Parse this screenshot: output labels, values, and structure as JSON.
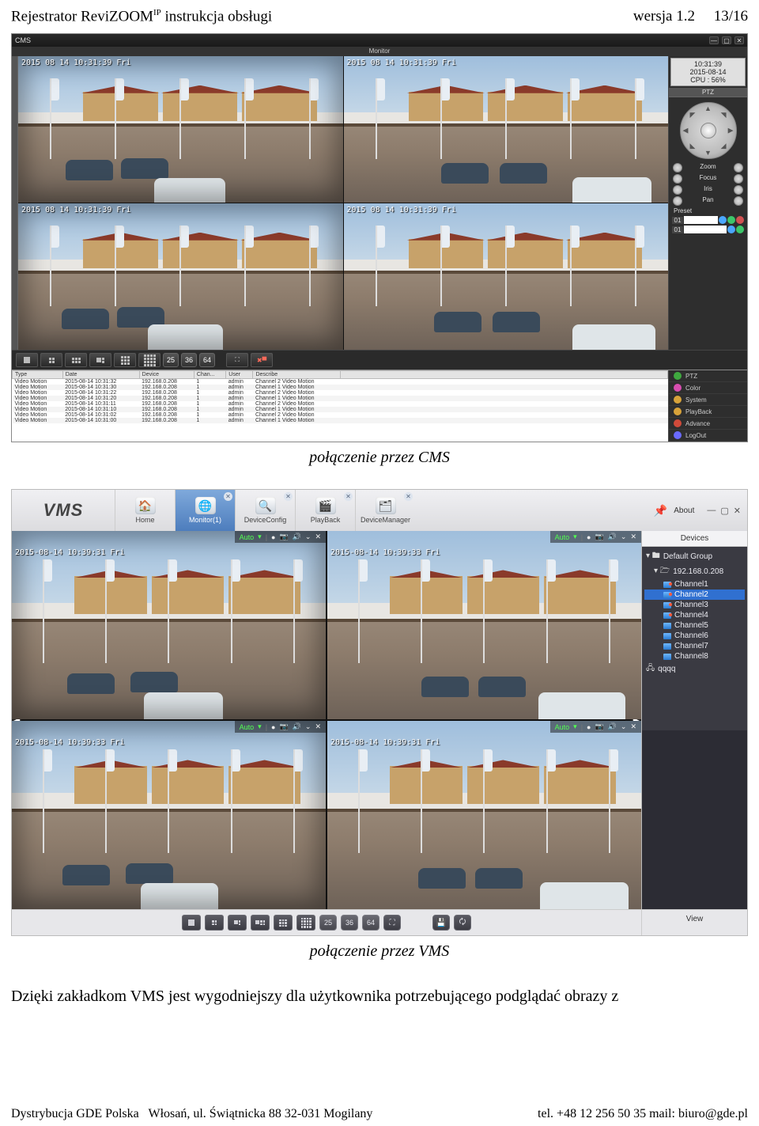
{
  "header": {
    "left_pre": "Rejestrator ReviZOOM",
    "left_sup": "IP",
    "left_post": " instrukcja obsługi",
    "right": "wersja 1.2     13/16"
  },
  "captions": {
    "cms": "połączenie przez CMS",
    "vms": "połączenie przez VMS"
  },
  "body_text": "Dzięki zakładkom VMS jest wygodniejszy dla użytkownika potrzebującego podglądać obrazy z",
  "footer": {
    "left": "Dystrybucja GDE Polska   Włosań, ul. Świątnicka 88 32-031 Mogilany",
    "right": "tel. +48 12 256 50 35 mail: biuro@gde.pl"
  },
  "cms": {
    "title": "CMS",
    "monitor_label": "Monitor",
    "time": {
      "clock": "10:31:39",
      "date": "2015-08-14",
      "cpu": "CPU : 56%"
    },
    "rail": {
      "ptz_label": "PTZ",
      "sliders": [
        "Zoom",
        "Focus",
        "Iris",
        "Pan"
      ],
      "preset_label": "Preset",
      "preset1": "01",
      "preset2": "01"
    },
    "grid_numbers": [
      "25",
      "36",
      "64"
    ],
    "feeds": {
      "ts1": "2015 08 14 10:31:39 Fri",
      "ts2": "2015 08 14 10:31:39 Fri",
      "ts3": "2015 08 14 10:31:39 Fri",
      "ts4": "2015 08 14 10:31:39 Fri"
    },
    "log_headers": [
      "Type",
      "Date",
      "Device",
      "Chan...",
      "User",
      "Describe"
    ],
    "log_rows": [
      [
        "Video Motion",
        "2015-08-14 10:31:32",
        "192.168.0.208",
        "1",
        "admin",
        "Channel 2 Video Motion"
      ],
      [
        "Video Motion",
        "2015-08-14 10:31:30",
        "192.168.0.208",
        "1",
        "admin",
        "Channel 1 Video Motion"
      ],
      [
        "Video Motion",
        "2015-08-14 10:31:22",
        "192.168.0.208",
        "1",
        "admin",
        "Channel 2 Video Motion"
      ],
      [
        "Video Motion",
        "2015-08-14 10:31:20",
        "192.168.0.208",
        "1",
        "admin",
        "Channel 1 Video Motion"
      ],
      [
        "Video Motion",
        "2015-08-14 10:31:11",
        "192.168.0.208",
        "1",
        "admin",
        "Channel 2 Video Motion"
      ],
      [
        "Video Motion",
        "2015-08-14 10:31:10",
        "192.168.0.208",
        "1",
        "admin",
        "Channel 1 Video Motion"
      ],
      [
        "Video Motion",
        "2015-08-14 10:31:02",
        "192.168.0.208",
        "1",
        "admin",
        "Channel 2 Video Motion"
      ],
      [
        "Video Motion",
        "2015-08-14 10:31:00",
        "192.168.0.208",
        "1",
        "admin",
        "Channel 1 Video Motion"
      ]
    ],
    "side_menu": [
      {
        "label": "PTZ",
        "color": "#3fa93f"
      },
      {
        "label": "Color",
        "color": "#d84db0"
      },
      {
        "label": "System",
        "color": "#d8a33a"
      },
      {
        "label": "PlayBack",
        "color": "#d8a33a"
      },
      {
        "label": "Advance",
        "color": "#d04a3a"
      },
      {
        "label": "LogOut",
        "color": "#6a6aff"
      }
    ]
  },
  "vms": {
    "logo": "VMS",
    "tabs": [
      {
        "label": "Home",
        "icon": "🏠",
        "closable": false
      },
      {
        "label": "Monitor(1)",
        "icon": "🌐",
        "closable": true,
        "selected": true
      },
      {
        "label": "DeviceConfig",
        "icon": "🔍",
        "closable": true
      },
      {
        "label": "PlayBack",
        "icon": "🎬",
        "closable": true
      },
      {
        "label": "DeviceManager",
        "icon": "🗂",
        "closable": true
      }
    ],
    "about": "About",
    "devices": {
      "header": "Devices",
      "root": "Default Group",
      "device_ip": "192.168.0.208",
      "channels": [
        "Channel1",
        "Channel2",
        "Channel3",
        "Channel4",
        "Channel5",
        "Channel6",
        "Channel7",
        "Channel8"
      ],
      "selected": "Channel2",
      "extra": "qqqq"
    },
    "grid_numbers": [
      "25",
      "36",
      "64"
    ],
    "view_label": "View",
    "feeds": {
      "auto": "Auto",
      "ts1": "2015-08-14 10:39:31 Fri",
      "ts2": "2015-08-14 10:39:33 Fri",
      "ts3": "2015-08-14 10:39:33 Fri",
      "ts4": "2015-08-14 10:39:31 Fri"
    }
  }
}
